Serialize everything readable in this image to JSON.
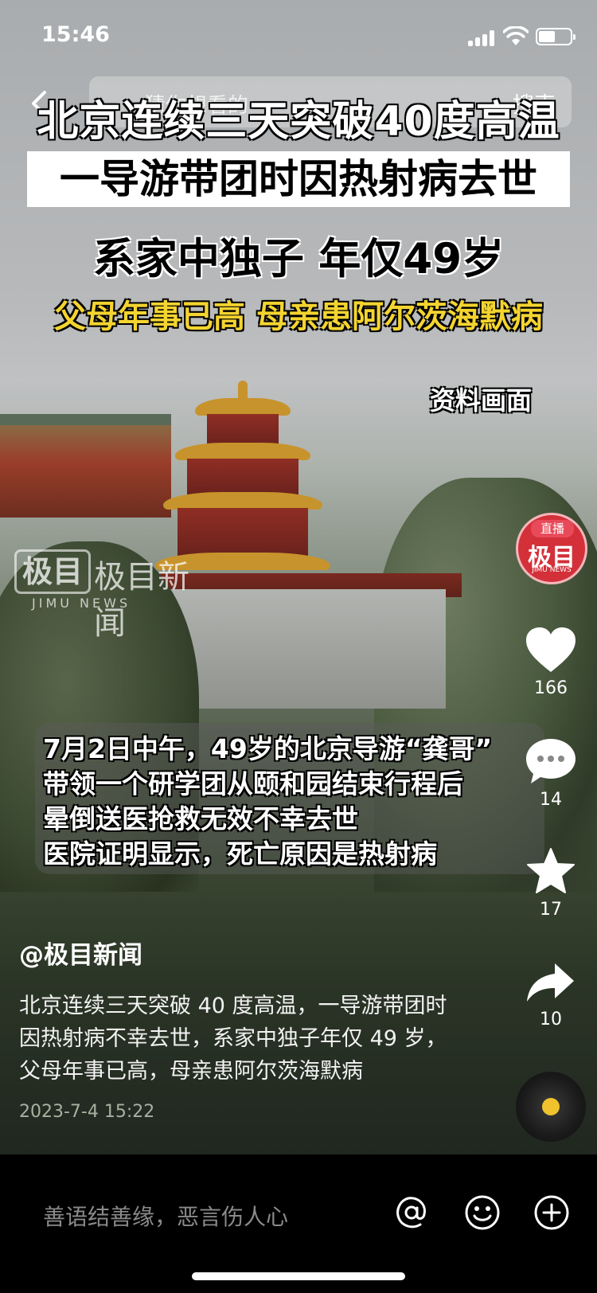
{
  "status_bar": {
    "time": "15:46"
  },
  "search": {
    "placeholder": "猜你想看的",
    "button": "搜索"
  },
  "overlay": {
    "headline1": "北京连续三天突破40度高温",
    "headline2": "一导游带团时因热射病去世",
    "headline3": "系家中独子 年仅49岁",
    "headline4": "父母年事已高 母亲患阿尔茨海默病",
    "archive_label": "资料画面",
    "watermark_cn": "极目新闻",
    "watermark_box": "极目",
    "watermark_en": "JIMU NEWS",
    "caption_lines": [
      "7月2日中午，49岁的北京导游“龚哥”",
      "带领一个研学团从颐和园结束行程后",
      "晕倒送医抢救无效不幸去世",
      " 医院证明显示，死亡原因是热射病"
    ]
  },
  "live_badge": {
    "tag": "直播",
    "logo": "极目",
    "sub": "JIMU NEWS"
  },
  "actions": {
    "like_count": "166",
    "comment_count": "14",
    "favorite_count": "17",
    "share_count": "10"
  },
  "post": {
    "author": "@极目新闻",
    "text": "北京连续三天突破 40 度高温，一导游带团时因热射病不幸去世，系家中独子年仅 49 岁，父母年事已高，母亲患阿尔茨海默病",
    "date": "2023-7-4 15:22"
  },
  "comment_bar": {
    "placeholder": "善语结善缘，恶言伤人心"
  }
}
